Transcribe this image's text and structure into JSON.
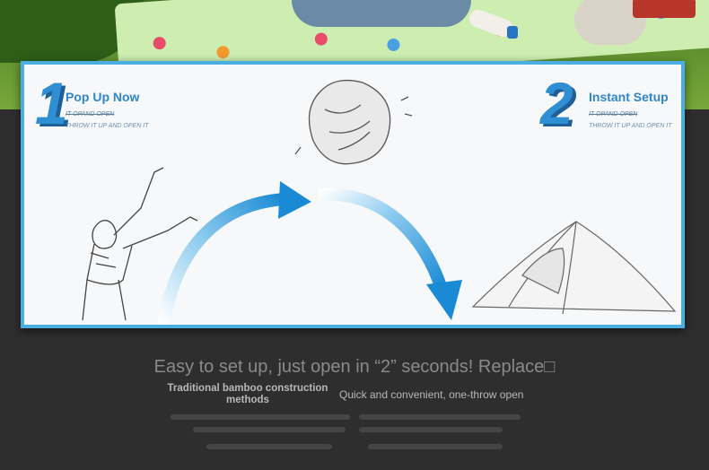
{
  "step1": {
    "number": "1",
    "title": "Pop Up Now",
    "sub1": "IT OPAND OPEN",
    "sub2": "THROW IT UP AND OPEN IT"
  },
  "step2": {
    "number": "2",
    "title": "Instant Setup",
    "sub1": "IT OPAND OPEN",
    "sub2": "THROW IT UP AND OPEN IT"
  },
  "headline": "Easy to set up, just open in “2” seconds! Replace□",
  "left_column": "Traditional bamboo construction methods",
  "right_column": "Quick and convenient, one-throw open",
  "colors": {
    "accent_blue": "#2f8fd2",
    "panel_border": "#4aaee0",
    "background": "#2e2e2e"
  }
}
